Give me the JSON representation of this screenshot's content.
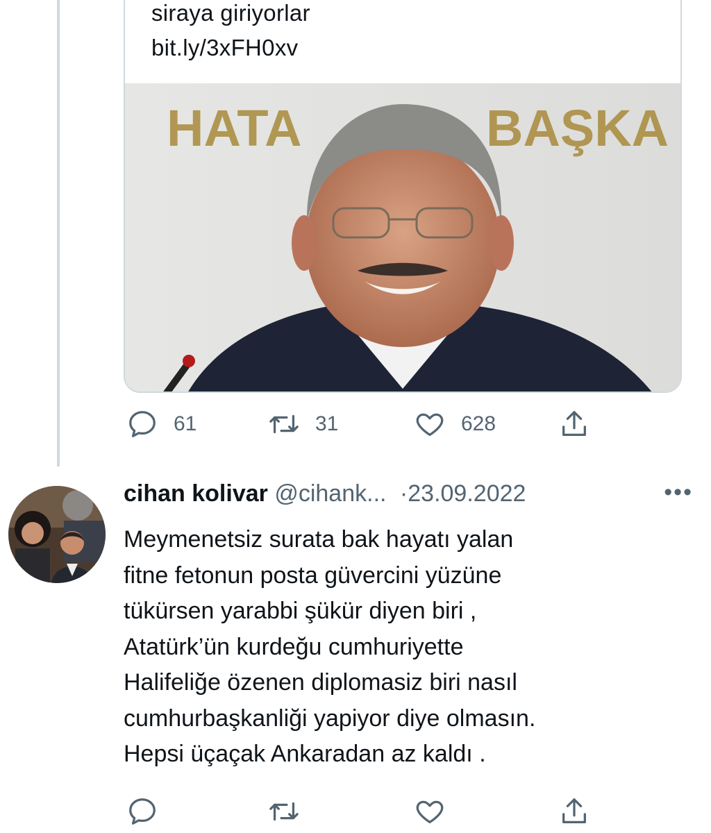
{
  "quoted_card": {
    "text_line1": "siraya giriyorlar",
    "text_line2": "bit.ly/3xFH0xv",
    "image_sign_left": "HATA",
    "image_sign_right": "BAŞKA"
  },
  "tweet1_actions": {
    "reply_count": "61",
    "retweet_count": "31",
    "like_count": "628"
  },
  "tweet2": {
    "name": "cihan kolivar",
    "handle": "@cihank...",
    "separator": "·",
    "date": "23.09.2022",
    "more": "•••",
    "body_lines": [
      "Meymenetsiz surata bak hayatı yalan",
      "fitne  fetonun posta güvercini yüzüne",
      "tükürsen yarabbi şükür diyen biri ,",
      "Atatürk’ün kurdeğu cumhuriyette",
      "Halifeliğe özenen diplomasiz biri nasıl",
      "cumhurbaşkanliği yapiyor diye olmasın.",
      "Hepsi üçaçak Ankaradan az kaldı ."
    ]
  },
  "icons": {
    "reply": "reply-icon",
    "retweet": "retweet-icon",
    "like": "heart-icon",
    "share": "share-icon",
    "more": "more-icon"
  },
  "colors": {
    "text": "#0f1419",
    "muted": "#536471",
    "border": "#cfd9de"
  }
}
